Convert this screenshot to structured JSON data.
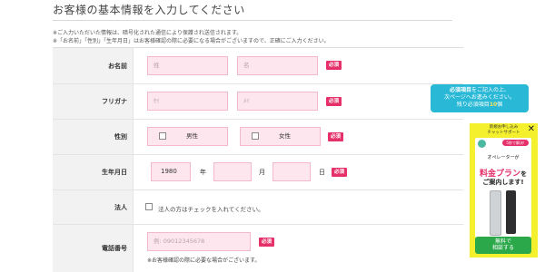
{
  "header": {
    "title": "お客様の基本情報を入力してください",
    "note1": "※ご入力いただいた情報は、暗号化された通信により保護され送信されます。",
    "note2": "※「お名前」「性別」「生年月日」はお客様確認の際に必要になる場合がございますので、正確にご入力ください。"
  },
  "form": {
    "required_badge": "必須",
    "name": {
      "label": "お名前",
      "last_placeholder": "姓",
      "first_placeholder": "名"
    },
    "furigana": {
      "label": "フリガナ",
      "last_placeholder": "ｾｲ",
      "first_placeholder": "ﾒｲ"
    },
    "gender": {
      "label": "性別",
      "male": "男性",
      "female": "女性"
    },
    "birthday": {
      "label": "生年月日",
      "year_value": "1980",
      "year_unit": "年",
      "month_unit": "月",
      "day_unit": "日"
    },
    "corporate": {
      "label": "法人",
      "checkbox_text": "法人の方はチェックを入れてください。"
    },
    "phone": {
      "label": "電話番号",
      "placeholder": "例: 09012345678",
      "note": "※お客様確認の際に必要な場合がございます。"
    }
  },
  "tooltip": {
    "line1_bold": "必須項目",
    "line1_rest": "をご記入の上、",
    "line2": "次ページへお進みください。",
    "line3_prefix": "残り必須項目",
    "remaining": "10",
    "line3_suffix": "個"
  },
  "ad": {
    "top_line1": "新規お申し込み",
    "top_line2": "チャットサポート",
    "close": "✕",
    "badge": "5秒で解決!",
    "operator_text": "オペレーターが",
    "highlight": "料金プラン",
    "highlight_suffix": "を",
    "guide_text": "ご案内します!",
    "button_line1": "無料で",
    "button_line2": "相談する",
    "colors": {
      "background": "#f4f02d",
      "accent": "#e5306a",
      "button": "#2aa84a"
    }
  }
}
